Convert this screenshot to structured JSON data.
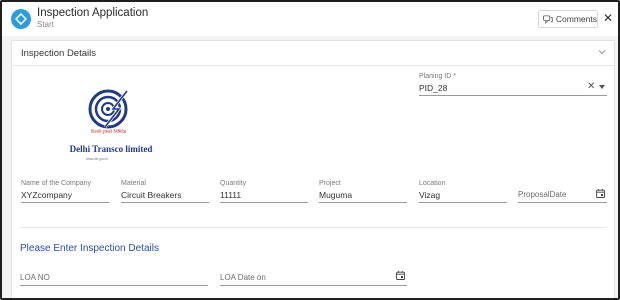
{
  "header": {
    "title": "Inspection Application",
    "subtitle": "Start",
    "comments_label": "Comments",
    "close_glyph": "✕",
    "icon": "diamond-icon"
  },
  "section": {
    "title": "Inspection Details",
    "chevron": "chevron-down-icon"
  },
  "logo": {
    "hindi_text": "दिल्ली ट्रांस्को लिमिटेड",
    "company_name": "Delhi Transco limited",
    "website": "www.dtl.gov.in"
  },
  "planing": {
    "label": "Planing ID *",
    "value": "PID_28"
  },
  "fields": {
    "company": {
      "label": "Name of the Company",
      "value": "XYZcompany"
    },
    "material": {
      "label": "Material",
      "value": "Circuit Breakers"
    },
    "quantity": {
      "label": "Quantity",
      "value": "11111"
    },
    "project": {
      "label": "Project",
      "value": "Muguma"
    },
    "location": {
      "label": "Location",
      "value": "Vizag"
    },
    "proposal_date": {
      "placeholder": "ProposalDate"
    }
  },
  "inspection": {
    "heading": "Please Enter Inspection Details",
    "loa_no": {
      "placeholder": "LOA NO"
    },
    "loa_date": {
      "placeholder": "LOA Date on"
    }
  },
  "colors": {
    "accent": "#2d9cdb",
    "heading_blue": "#2553a4",
    "logo_blue": "#1f3a8a",
    "logo_red": "#c0392b"
  }
}
